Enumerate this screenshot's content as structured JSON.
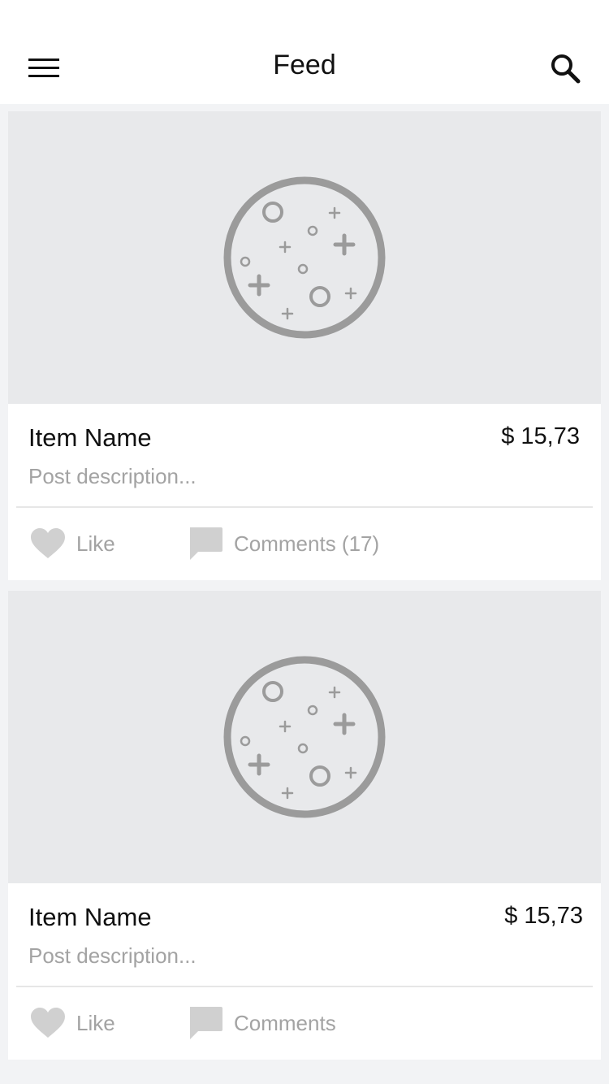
{
  "nav": {
    "title": "Feed",
    "menu_icon": "hamburger-menu-icon",
    "search_icon": "search-icon"
  },
  "posts": [
    {
      "image_icon": "placeholder-image-icon",
      "name": "Item Name",
      "price": "$ 15,73",
      "description": "Post description...",
      "like_label": "Like",
      "comments_label": "Comments (17)"
    },
    {
      "image_icon": "placeholder-image-icon",
      "name": "Item Name",
      "price": "$ 15,73",
      "description": "Post description...",
      "like_label": "Like",
      "comments_label": "Comments"
    }
  ],
  "colors": {
    "background": "#f2f3f5",
    "card": "#ffffff",
    "image_placeholder": "#e8e9eb",
    "placeholder_icon": "#9b9b9b",
    "muted_text": "#a3a3a3",
    "action_icon": "#d0d0d0"
  }
}
